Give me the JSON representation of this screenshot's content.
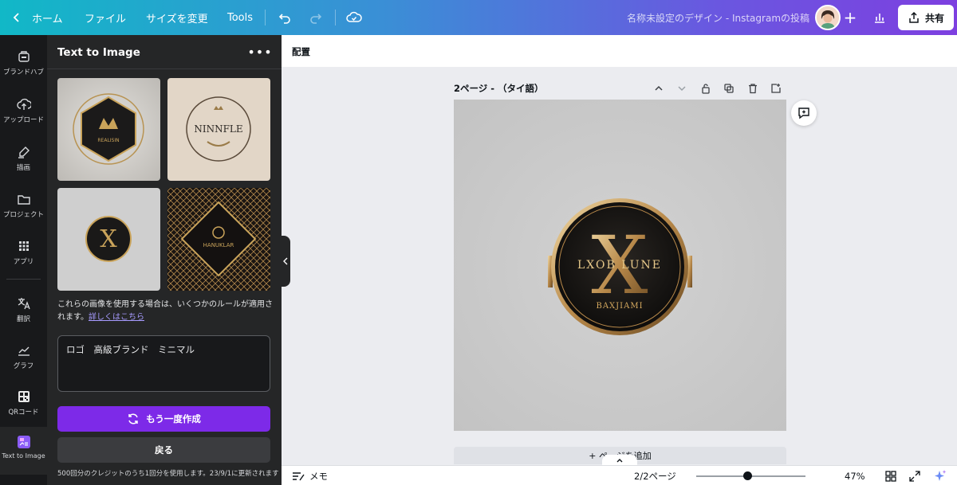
{
  "topbar": {
    "home_label": "ホーム",
    "file_label": "ファイル",
    "resize_label": "サイズを変更",
    "tools_label": "Tools",
    "doc_title": "名称未設定のデザイン - Instagramの投稿",
    "share_label": "共有",
    "plus_glyph": "+"
  },
  "rail": {
    "items": [
      {
        "label": "ブランドハブ",
        "icon": "brand-hub-icon"
      },
      {
        "label": "アップロード",
        "icon": "upload-cloud-icon"
      },
      {
        "label": "描画",
        "icon": "draw-pen-icon"
      },
      {
        "label": "プロジェクト",
        "icon": "folder-icon"
      },
      {
        "label": "アプリ",
        "icon": "apps-grid-icon"
      },
      {
        "label": "翻訳",
        "icon": "translate-icon"
      },
      {
        "label": "グラフ",
        "icon": "chart-line-icon"
      },
      {
        "label": "QRコード",
        "icon": "qr-code-icon"
      },
      {
        "label": "Text to Image",
        "icon": "text-to-image-icon"
      }
    ]
  },
  "panel": {
    "title": "Text to Image",
    "more_glyph": "•••",
    "thumbnails": [
      {
        "alt": "generated-logo-1",
        "text": "REALISIN"
      },
      {
        "alt": "generated-logo-2",
        "text": "NINNFLE"
      },
      {
        "alt": "generated-logo-3",
        "text": "X"
      },
      {
        "alt": "generated-logo-4",
        "text": "HANUKLAR"
      }
    ],
    "notice_text": "これらの画像を使用する場合は、いくつかのルールが適用されます。",
    "notice_link": "詳しくはこちら",
    "prompt_value": "ロゴ　高級ブランド　ミニマル",
    "regenerate_label": "もう一度作成",
    "back_label": "戻る",
    "credits_text": "500回分のクレジットのうち1回分を使用します。23/9/1に更新されます"
  },
  "editor": {
    "context_label": "配置",
    "page_label": "2ページ - （タイ語）",
    "add_page_label": "+ ページを追加",
    "logo": {
      "top_text": "LXOB LUNE",
      "letter": "X",
      "sub_text": "BAXJIAMI"
    }
  },
  "footer": {
    "memo_label": "メモ",
    "page_count": "2/2ページ",
    "zoom": "47%",
    "zoom_fraction": 0.47
  },
  "colors": {
    "accent_purple": "#7d2ae8",
    "panel_bg": "#252627",
    "rail_bg": "#18191b",
    "canvas_bg": "#ebecf0"
  }
}
